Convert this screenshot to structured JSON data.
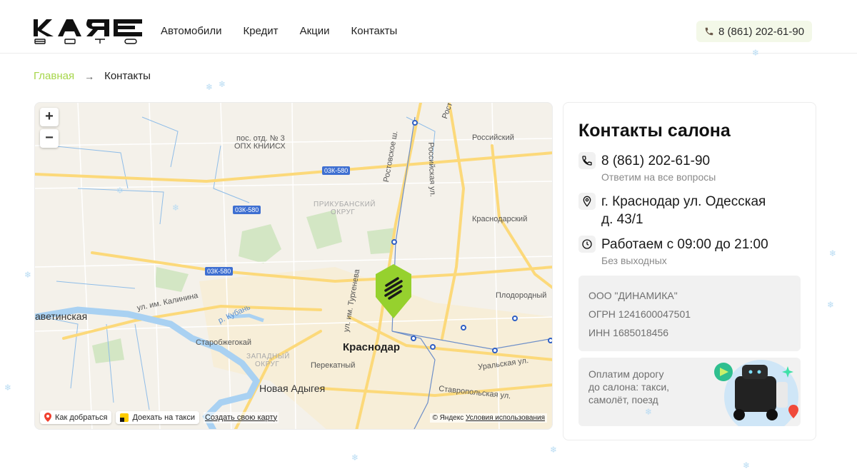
{
  "brand": {
    "logo_text": "КАЯ авто",
    "accent_color": "#a6d64a"
  },
  "nav": {
    "items": [
      {
        "label": "Автомобили"
      },
      {
        "label": "Кредит"
      },
      {
        "label": "Акции"
      },
      {
        "label": "Контакты"
      }
    ],
    "phone": "8 (861) 202-61-90"
  },
  "breadcrumb": {
    "home": "Главная",
    "arrow": "→",
    "current": "Контакты"
  },
  "map": {
    "zoom_in": "+",
    "zoom_out": "−",
    "labels": {
      "station": "пос. отд. № 3",
      "station2": "ОПХ КНИИСХ",
      "rossiysky": "Российский",
      "prikuban1": "ПРИКУБАНСКИЙ",
      "prikuban2": "ОКРУГ",
      "krasnodarsky": "Краснодарский",
      "plodorodny": "Плодородный",
      "elizavetinskaya": "аветинская",
      "kalinina": "ул. им. Калинина",
      "kuban": "р. Кубань",
      "starobzhegokai": "Старобжегокай",
      "zapadny1": "ЗАПАДНЫЙ",
      "zapadny2": "ОКРУГ",
      "perekatny": "Перекатный",
      "novaya_adygeya": "Новая Адыгея",
      "krasnodar": "Краснодар",
      "uralskaya": "Уральская ул.",
      "stavropolskaya": "Ставропольская ул.",
      "rostovskoe": "Ростовское ш.",
      "rossiyskaya": "Российская ул.",
      "turgeneva": "ул. им. Тургенева",
      "rostov_top": "Ростов"
    },
    "road_badges": [
      "03К-580",
      "03К-580",
      "03К-580"
    ],
    "route_label": "Как добраться",
    "taxi_label": "Доехать на такси",
    "create_map": "Создать свою карту",
    "copyright": "© Яндекс",
    "terms": "Условия использования"
  },
  "contacts": {
    "title": "Контакты салона",
    "phone": "8 (861) 202-61-90",
    "phone_note": "Ответим на все вопросы",
    "address_line1": "г. Краснодар ул. Одесская",
    "address_line2": "д. 43/1",
    "hours": "Работаем с 09:00 до 21:00",
    "hours_note": "Без выходных",
    "legal": {
      "company": "ООО \"ДИНАМИКА\"",
      "ogrn": "ОГРН 1241600047501",
      "inn": "ИНН 1685018456"
    },
    "promo": {
      "line1": "Оплатим дорогу",
      "line2": "до салона: такси,",
      "line3": "самолёт, поезд"
    }
  }
}
